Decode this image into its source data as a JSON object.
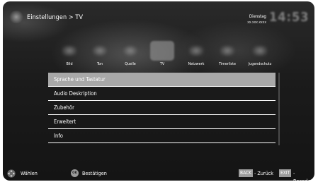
{
  "header": {
    "breadcrumb": "Einstellungen > TV",
    "day": "Dienstag",
    "date": "xx.xxx.xxxx"
  },
  "tabs": [
    {
      "label": "Bild",
      "icon": "picture-icon",
      "active": false
    },
    {
      "label": "Ton",
      "icon": "sound-icon",
      "active": false
    },
    {
      "label": "Quelle",
      "icon": "source-icon",
      "active": false
    },
    {
      "label": "TV",
      "icon": "tv-icon",
      "active": true
    },
    {
      "label": "Netzwerk",
      "icon": "network-icon",
      "active": false
    },
    {
      "label": "Timerliste",
      "icon": "timer-icon",
      "active": false
    },
    {
      "label": "Jugendschutz",
      "icon": "lock-icon",
      "active": false
    }
  ],
  "menu": {
    "items": [
      {
        "label": "Sprache und Tastatur",
        "selected": true
      },
      {
        "label": "Audio Deskription",
        "selected": false
      },
      {
        "label": "Zubehör",
        "selected": false
      },
      {
        "label": "Erweitert",
        "selected": false
      },
      {
        "label": "Info",
        "selected": false
      }
    ]
  },
  "footer": {
    "select_label": "Wählen",
    "ok_key": "OK",
    "confirm_label": "Bestätigen",
    "back_key": "BACK",
    "back_label": "- Zurück",
    "exit_key": "EXIT",
    "exit_label": "- Beenden"
  },
  "colors": {
    "selected_row": "#a8a8a8",
    "background": "#1b1b1b",
    "key_badge": "#9c9c9c"
  }
}
